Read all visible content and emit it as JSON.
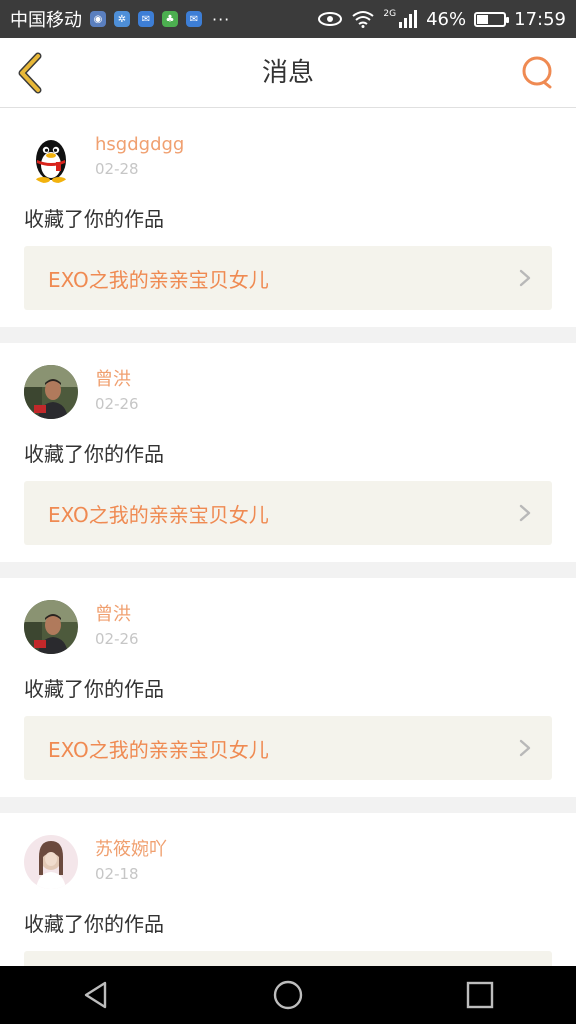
{
  "status_bar": {
    "carrier": "中国移动",
    "network_type": "2G",
    "battery": "46%",
    "battery_level": 0.46,
    "time": "17:59",
    "overflow": "···"
  },
  "header": {
    "title": "消息"
  },
  "messages": [
    {
      "username": "hsgdgdgg",
      "date": "02-28",
      "action": "收藏了你的作品",
      "work_title": "EXO之我的亲亲宝贝女儿",
      "avatar": "qq-penguin-avatar"
    },
    {
      "username": "曾洪",
      "date": "02-26",
      "action": "收藏了你的作品",
      "work_title": "EXO之我的亲亲宝贝女儿",
      "avatar": "user-photo-avatar"
    },
    {
      "username": "曾洪",
      "date": "02-26",
      "action": "收藏了你的作品",
      "work_title": "EXO之我的亲亲宝贝女儿",
      "avatar": "user-photo-avatar"
    },
    {
      "username": "苏筱婉吖",
      "date": "02-18",
      "action": "收藏了你的作品",
      "work_title": "",
      "avatar": "girl-photo-avatar"
    }
  ],
  "colors": {
    "accent": "#ef8a52",
    "back_arrow": "#e8b838",
    "status_bar": "#3b3b3b",
    "card_link_bg": "#f4f3ec"
  }
}
